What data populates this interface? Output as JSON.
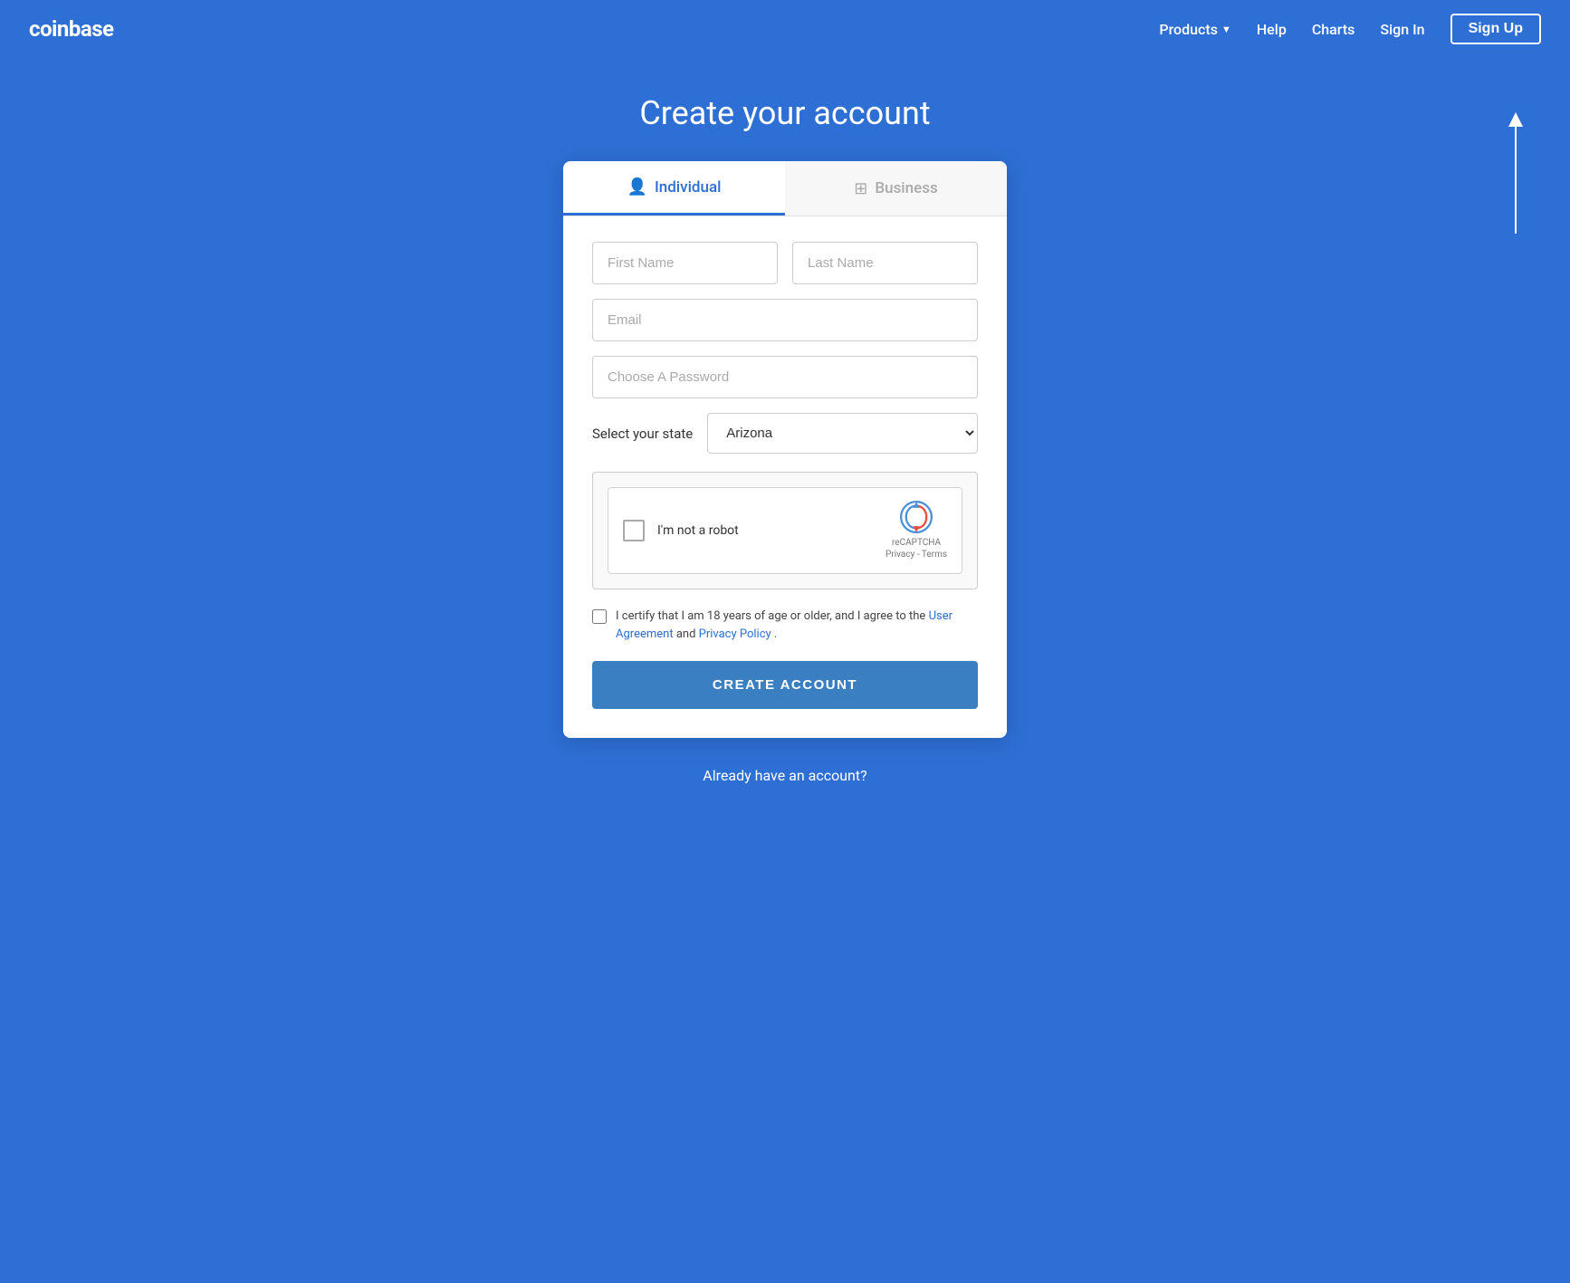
{
  "nav": {
    "logo": "coinbase",
    "links": {
      "products": "Products",
      "help": "Help",
      "charts": "Charts",
      "signin": "Sign In",
      "signup": "Sign Up"
    }
  },
  "page": {
    "title": "Create your account"
  },
  "tabs": {
    "individual": "Individual",
    "business": "Business"
  },
  "form": {
    "first_name_placeholder": "First Name",
    "last_name_placeholder": "Last Name",
    "email_placeholder": "Email",
    "password_placeholder": "Choose A Password",
    "state_label": "Select your state",
    "state_value": "Arizona",
    "recaptcha_text": "I'm not a robot",
    "recaptcha_brand": "reCAPTCHA",
    "recaptcha_privacy": "Privacy",
    "recaptcha_terms": "Terms",
    "terms_text": "I certify that I am 18 years of age or older, and I agree to the",
    "terms_user_agreement": "User Agreement",
    "terms_and": "and",
    "terms_privacy_policy": "Privacy Policy",
    "terms_period": ".",
    "create_button": "CREATE ACCOUNT"
  },
  "footer": {
    "already_account": "Already have an account?"
  }
}
